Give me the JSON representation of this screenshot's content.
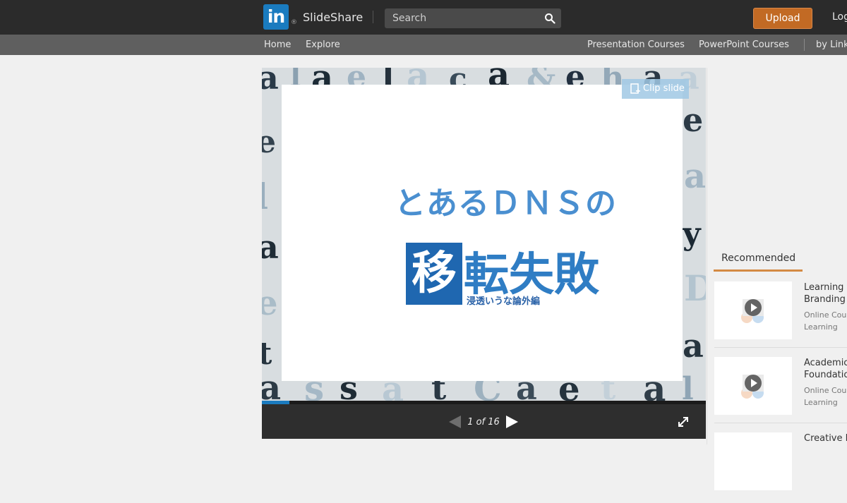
{
  "header": {
    "logo_mark": "in",
    "logo_registered": "®",
    "logo_text": "SlideShare",
    "search_placeholder": "Search",
    "upload_label": "Upload",
    "login_label": "Log"
  },
  "subnav": {
    "home": "Home",
    "explore": "Explore",
    "presentation_courses": "Presentation Courses",
    "powerpoint_courses": "PowerPoint Courses",
    "by_linkedin": "by Link"
  },
  "viewer": {
    "clip_label": "Clip slide",
    "slide_title_line1": "とあるＤＮＳの",
    "slide_title_box_char": "移",
    "slide_title_rest": "転失敗",
    "slide_subtitle": "浸透いうな論外編",
    "current_page": 1,
    "total_pages": 16,
    "page_counter": "1 of 16"
  },
  "recommended": {
    "tab_label": "Recommended",
    "items": [
      {
        "title1": "Learning to",
        "title2": "Branding",
        "sub1": "Online Course",
        "sub2": "Learning"
      },
      {
        "title1": "Academic",
        "title2": "Foundations",
        "sub1": "Online Course",
        "sub2": "Learning"
      },
      {
        "title1": "Creative Inspiration",
        "title2": "",
        "sub1": "",
        "sub2": ""
      }
    ]
  },
  "colors": {
    "topbar": "#2b2b2b",
    "subnav": "#5f5f5f",
    "upload": "#c26a24",
    "accent_blue": "#1b7bbf",
    "tab_underline": "#d48a43"
  }
}
